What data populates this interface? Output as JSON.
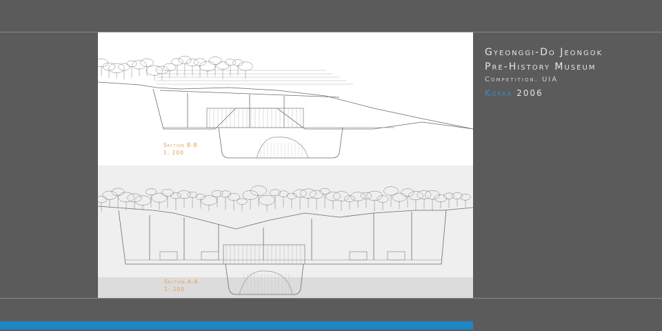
{
  "header": {
    "line1": "Gyeonggi-Do Jeongok",
    "line2": "Pre-History Museum",
    "line3": "Competition. UIA",
    "country": "Korea",
    "year": "2006"
  },
  "drawings": {
    "section_bb": {
      "title": "Section B-B",
      "scale": "1: 200"
    },
    "section_aa": {
      "title": "Section A-A",
      "scale": "1: 200"
    }
  },
  "colors": {
    "background": "#5b5b5b",
    "panel": "#ffffff",
    "label_orange": "#e89a4a",
    "accent_blue": "#1f86c6",
    "title_text": "#e6e6e6"
  }
}
